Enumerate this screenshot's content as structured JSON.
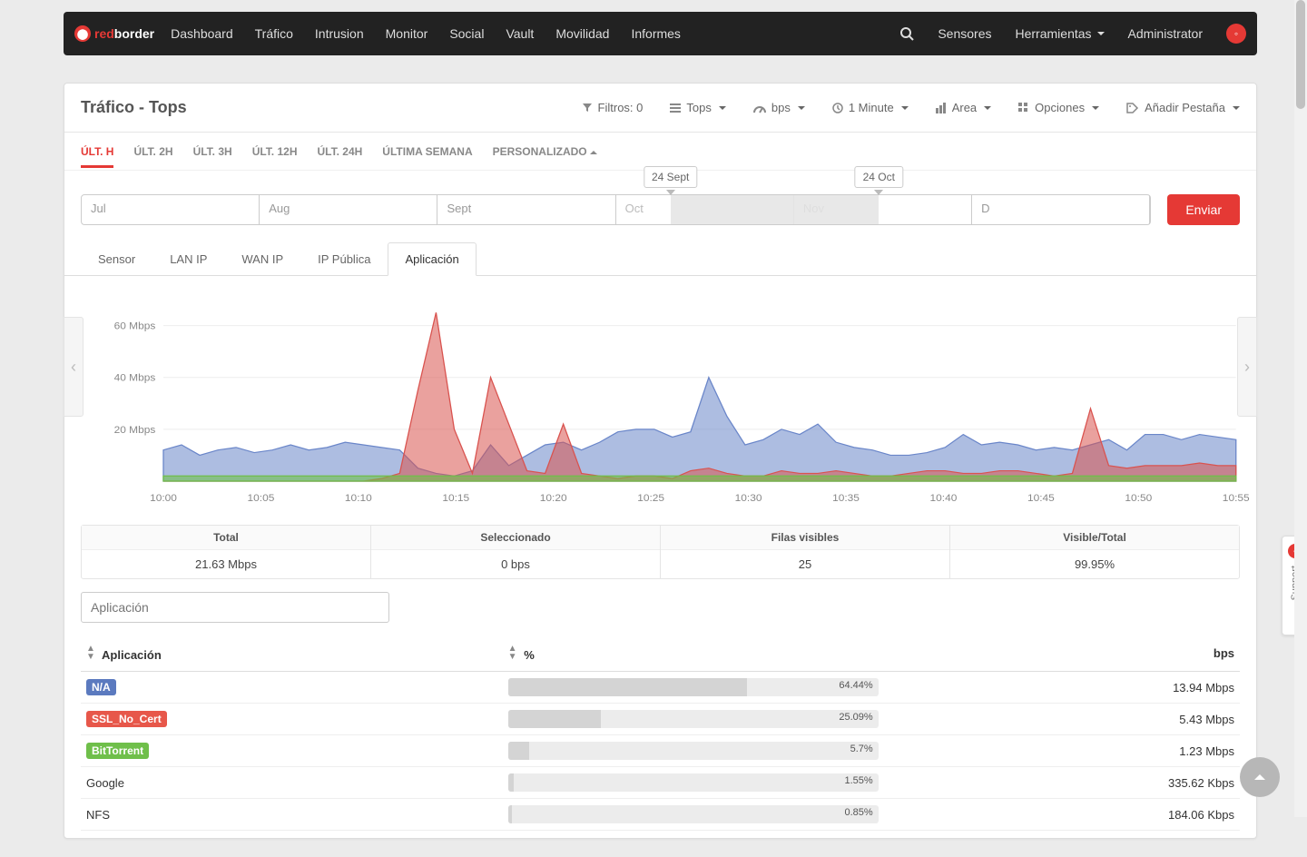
{
  "brand": {
    "prefix": "red",
    "suffix": "border"
  },
  "nav": {
    "items": [
      "Dashboard",
      "Tráfico",
      "Intrusion",
      "Monitor",
      "Social",
      "Vault",
      "Movilidad",
      "Informes"
    ],
    "right": {
      "sensores": "Sensores",
      "herramientas": "Herramientas",
      "admin": "Administrator"
    }
  },
  "page": {
    "title": "Tráfico - Tops"
  },
  "toolbar": {
    "filtros_label": "Filtros: 0",
    "tops": "Tops",
    "bps": "bps",
    "minute": "1 Minute",
    "area": "Area",
    "opciones": "Opciones",
    "anadir": "Añadir Pestaña"
  },
  "ranges": [
    "ÚLT. H",
    "ÚLT. 2H",
    "ÚLT. 3H",
    "ÚLT. 12H",
    "ÚLT. 24H",
    "ÚLTIMA SEMANA",
    "PERSONALIZADO"
  ],
  "timeline": {
    "months": [
      "Jul",
      "Aug",
      "Sept",
      "Oct",
      "Nov",
      "D"
    ],
    "start_label": "24 Sept",
    "end_label": "24 Oct",
    "submit": "Enviar"
  },
  "tabs2": [
    "Sensor",
    "LAN IP",
    "WAN IP",
    "IP Pública",
    "Aplicación"
  ],
  "chart_data": {
    "type": "area",
    "ylabel_suffix": " Mbps",
    "yticks": [
      20,
      40,
      60
    ],
    "x": [
      "10:00",
      "10:05",
      "10:10",
      "10:15",
      "10:20",
      "10:25",
      "10:30",
      "10:35",
      "10:40",
      "10:45",
      "10:50",
      "10:55"
    ],
    "series": [
      {
        "name": "N/A (blue)",
        "color": "#6a86c9",
        "fill": "rgba(106,134,201,0.55)",
        "values_60": [
          12,
          14,
          10,
          12,
          13,
          11,
          12,
          14,
          12,
          13,
          15,
          14,
          13,
          12,
          5,
          3,
          2,
          4,
          14,
          6,
          10,
          14,
          15,
          12,
          15,
          19,
          20,
          20,
          17,
          19,
          40,
          25,
          14,
          16,
          20,
          18,
          22,
          15,
          13,
          12,
          10,
          10,
          11,
          13,
          18,
          14,
          15,
          14,
          12,
          13,
          12,
          14,
          16,
          12,
          18,
          18,
          16,
          18,
          17,
          16
        ]
      },
      {
        "name": "SSL_No_Cert (red)",
        "color": "#d9534f",
        "fill": "rgba(217,83,79,0.55)",
        "values_60": [
          0,
          0,
          0,
          0,
          0,
          0,
          0,
          0,
          0,
          0,
          0,
          0,
          1,
          3,
          35,
          65,
          20,
          3,
          40,
          22,
          4,
          3,
          22,
          3,
          2,
          1,
          2,
          2,
          1,
          4,
          5,
          3,
          2,
          2,
          4,
          3,
          3,
          4,
          3,
          2,
          2,
          3,
          4,
          4,
          3,
          3,
          4,
          4,
          3,
          2,
          3,
          28,
          6,
          5,
          6,
          6,
          6,
          7,
          6,
          6
        ]
      },
      {
        "name": "BitTorrent (green)",
        "color": "#6fbf4a",
        "fill": "rgba(111,191,74,0.6)",
        "values_60": [
          2,
          2,
          2,
          2,
          2,
          2,
          2,
          2,
          2,
          2,
          2,
          2,
          2,
          2,
          2,
          2,
          2,
          2,
          2,
          2,
          2,
          2,
          2,
          2,
          2,
          2,
          2,
          2,
          2,
          2,
          2,
          2,
          2,
          2,
          2,
          2,
          2,
          2,
          2,
          2,
          2,
          2,
          2,
          2,
          2,
          2,
          2,
          2,
          2,
          2,
          2,
          2,
          2,
          2,
          2,
          2,
          2,
          2,
          2,
          2
        ]
      }
    ],
    "ymax": 70
  },
  "summary": {
    "headers": [
      "Total",
      "Seleccionado",
      "Filas visibles",
      "Visible/Total"
    ],
    "values": [
      "21.63 Mbps",
      "0 bps",
      "25",
      "99.95%"
    ]
  },
  "filter_placeholder": "Aplicación",
  "table": {
    "headers": {
      "app": "Aplicación",
      "pct": "%",
      "bps": "bps"
    },
    "rows": [
      {
        "label": "N/A",
        "tag": "blue",
        "pct": 64.44,
        "pct_txt": "64.44%",
        "bps": "13.94 Mbps"
      },
      {
        "label": "SSL_No_Cert",
        "tag": "red",
        "pct": 25.09,
        "pct_txt": "25.09%",
        "bps": "5.43 Mbps"
      },
      {
        "label": "BitTorrent",
        "tag": "green",
        "pct": 5.7,
        "pct_txt": "5.7%",
        "bps": "1.23 Mbps"
      },
      {
        "label": "Google",
        "tag": "",
        "pct": 1.55,
        "pct_txt": "1.55%",
        "bps": "335.62 Kbps"
      },
      {
        "label": "NFS",
        "tag": "",
        "pct": 0.85,
        "pct_txt": "0.85%",
        "bps": "184.06 Kbps"
      }
    ]
  },
  "support": "Support"
}
